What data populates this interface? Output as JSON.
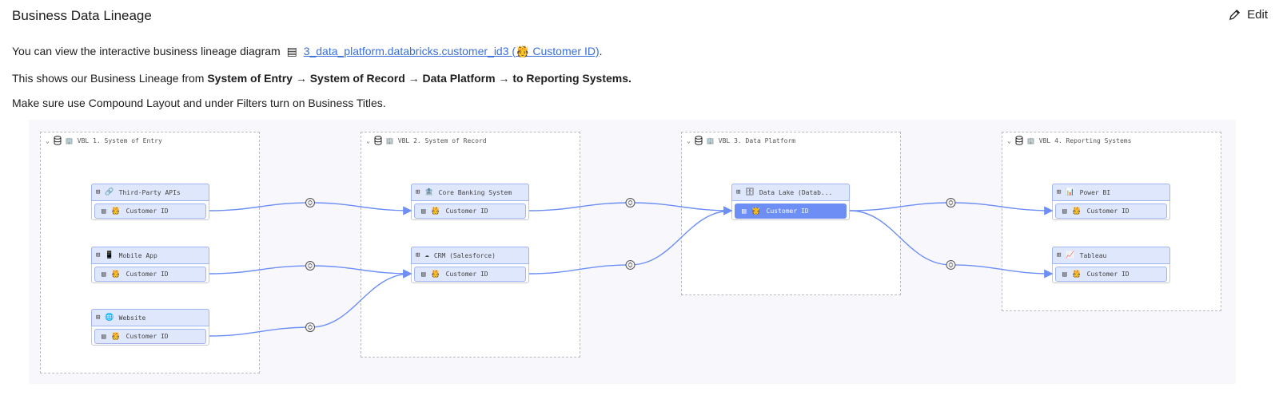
{
  "header": {
    "title": "Business Data Lineage",
    "edit_label": "Edit"
  },
  "intro": {
    "line1_prefix": "You can view the interactive business lineage diagram",
    "line1_link": "3_data_platform.databricks.customer_id3 (",
    "line1_link_suffix": " Customer ID)",
    "line1_end": ".",
    "line2_prefix": "This shows our Business Lineage from ",
    "line2_bold": "System of Entry → System of Record → Data Platform → to Reporting Systems.",
    "line3": "Make sure use Compound Layout and under Filters turn on Business Titles."
  },
  "colors": {
    "accent": "#6c8ef5",
    "node_bg": "#dfe7fc",
    "link": "#3b6fd9"
  },
  "groups": [
    {
      "label": "VBL 1. System of Entry"
    },
    {
      "label": "VBL 2. System of Record"
    },
    {
      "label": "VBL 3. Data Platform"
    },
    {
      "label": "VBL 4. Reporting Systems"
    }
  ],
  "nodes": [
    {
      "title": "Third-Party APIs",
      "icon": "🔗",
      "field": "Customer ID"
    },
    {
      "title": "Mobile App",
      "icon": "📱",
      "field": "Customer ID"
    },
    {
      "title": "Website",
      "icon": "🌐",
      "field": "Customer ID"
    },
    {
      "title": "Core Banking System",
      "icon": "🏦",
      "field": "Customer ID"
    },
    {
      "title": "CRM (Salesforce)",
      "icon": "☁",
      "field": "Customer ID"
    },
    {
      "title": "Data Lake (Datab...",
      "icon": "🗄",
      "field": "Customer ID",
      "selected": true
    },
    {
      "title": "Power BI",
      "icon": "📊",
      "field": "Customer ID"
    },
    {
      "title": "Tableau",
      "icon": "📈",
      "field": "Customer ID"
    }
  ],
  "edges": [
    {
      "from": "Third-Party APIs",
      "to": "Core Banking System"
    },
    {
      "from": "Mobile App",
      "to": "CRM (Salesforce)"
    },
    {
      "from": "Website",
      "to": "CRM (Salesforce)"
    },
    {
      "from": "Core Banking System",
      "to": "Data Lake (Datab..."
    },
    {
      "from": "CRM (Salesforce)",
      "to": "Data Lake (Datab..."
    },
    {
      "from": "Data Lake (Datab...",
      "to": "Power BI"
    },
    {
      "from": "Data Lake (Datab...",
      "to": "Tableau"
    }
  ]
}
